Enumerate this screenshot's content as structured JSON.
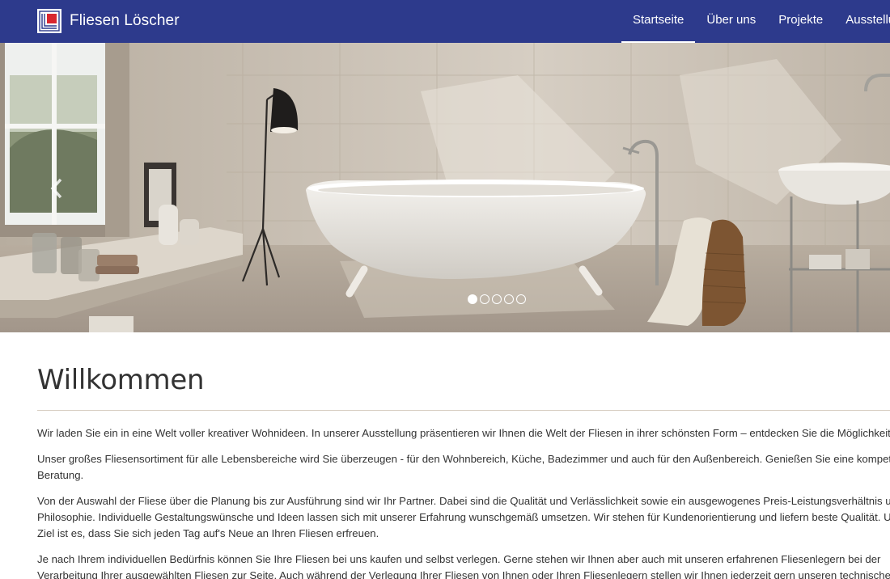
{
  "brand": {
    "name": "Fliesen Löscher",
    "logo_icon": "tile-logo-icon"
  },
  "nav": {
    "items": [
      {
        "label": "Startseite",
        "active": true
      },
      {
        "label": "Über uns",
        "active": false
      },
      {
        "label": "Projekte",
        "active": false
      },
      {
        "label": "Ausstellung",
        "active": false
      }
    ]
  },
  "carousel": {
    "prev_icon": "chevron-left-icon",
    "slide_count": 5,
    "active_index": 0
  },
  "main": {
    "title": "Willkommen",
    "paragraphs": [
      [
        "Wir laden Sie ein in eine Welt voller kreativer Wohnideen. In unserer Ausstellung präsentieren wir Ihnen die Welt der Fliesen in ihrer schönsten Form – entdecken Sie die Möglichkeiten"
      ],
      [
        "Unser großes Fliesensortiment für alle Lebensbereiche wird Sie überzeugen - für den Wohnbereich, Küche, Badezimmer und auch für den Außenbereich. Genießen Sie eine kompetente",
        "Beratung."
      ],
      [
        "Von der Auswahl der Fliese über die Planung bis zur Ausführung sind wir Ihr Partner. Dabei sind die Qualität und Verlässlichkeit sowie ein ausgewogenes Preis-Leistungsverhältnis unsere",
        "Philosophie. Individuelle Gestaltungswünsche und Ideen lassen sich mit unserer Erfahrung wunschgemäß umsetzen. Wir stehen für Kundenorientierung und liefern beste Qualität. Unser",
        "Ziel ist es, dass Sie sich jeden Tag auf's Neue an Ihren Fliesen erfreuen."
      ],
      [
        "Je nach Ihrem individuellen Bedürfnis können Sie Ihre Fliesen bei uns kaufen und selbst verlegen. Gerne stehen wir Ihnen aber auch mit unseren erfahrenen Fliesenlegern bei der",
        "Verarbeitung Ihrer ausgewählten Fliesen zur Seite. Auch während der Verlegung Ihrer Fliesen von Ihnen oder Ihren Fliesenlegern stellen wir Ihnen jederzeit gern unseren technischen"
      ]
    ]
  },
  "colors": {
    "navbar": "#2d3a8c",
    "logo_red": "#d9262e",
    "divider": "#d8cfc4"
  }
}
